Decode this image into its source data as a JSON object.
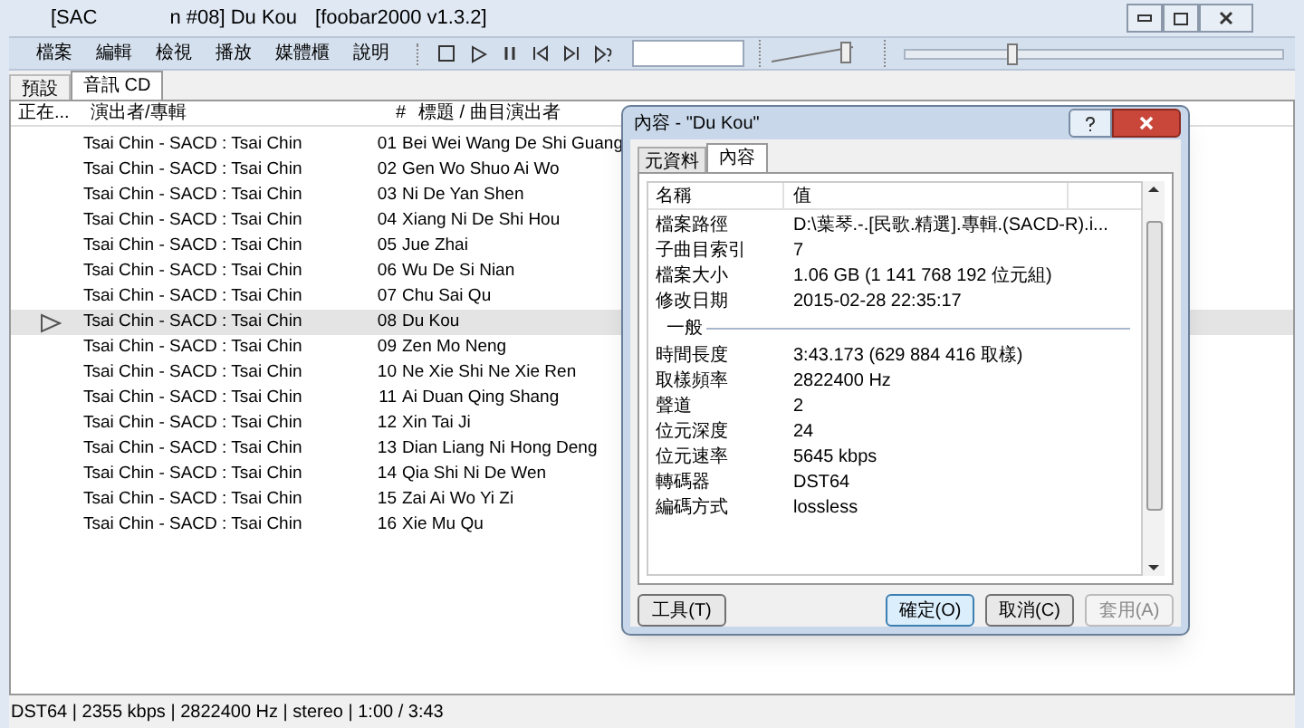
{
  "window": {
    "title_fragments": [
      "[SAC",
      "n #08] Du Kou",
      "[foobar2000 v1.3.2]"
    ]
  },
  "menu": [
    "檔案",
    "編輯",
    "檢視",
    "播放",
    "媒體櫃",
    "說明"
  ],
  "volume": {
    "level": 0.95
  },
  "seek": {
    "level": 0.27
  },
  "tabs": [
    {
      "label": "預設",
      "selected": false
    },
    {
      "label": "音訊 CD",
      "selected": true
    }
  ],
  "playlist": {
    "columns": [
      "正在...",
      "演出者/專輯",
      "#",
      "標題 / 曲目演出者"
    ],
    "rows": [
      {
        "artist": "Tsai Chin - SACD : Tsai Chin",
        "track": "01",
        "title": "Bei Wei Wang De Shi Guang",
        "playing": false,
        "selected": false
      },
      {
        "artist": "Tsai Chin - SACD : Tsai Chin",
        "track": "02",
        "title": "Gen Wo Shuo Ai Wo",
        "playing": false,
        "selected": false
      },
      {
        "artist": "Tsai Chin - SACD : Tsai Chin",
        "track": "03",
        "title": "Ni De Yan Shen",
        "playing": false,
        "selected": false
      },
      {
        "artist": "Tsai Chin - SACD : Tsai Chin",
        "track": "04",
        "title": "Xiang Ni De Shi Hou",
        "playing": false,
        "selected": false
      },
      {
        "artist": "Tsai Chin - SACD : Tsai Chin",
        "track": "05",
        "title": "Jue Zhai",
        "playing": false,
        "selected": false
      },
      {
        "artist": "Tsai Chin - SACD : Tsai Chin",
        "track": "06",
        "title": "Wu De Si Nian",
        "playing": false,
        "selected": false
      },
      {
        "artist": "Tsai Chin - SACD : Tsai Chin",
        "track": "07",
        "title": "Chu Sai Qu",
        "playing": false,
        "selected": false
      },
      {
        "artist": "Tsai Chin - SACD : Tsai Chin",
        "track": "08",
        "title": "Du Kou",
        "playing": true,
        "selected": true
      },
      {
        "artist": "Tsai Chin - SACD : Tsai Chin",
        "track": "09",
        "title": "Zen Mo Neng",
        "playing": false,
        "selected": false
      },
      {
        "artist": "Tsai Chin - SACD : Tsai Chin",
        "track": "10",
        "title": "Ne Xie Shi Ne Xie Ren",
        "playing": false,
        "selected": false
      },
      {
        "artist": "Tsai Chin - SACD : Tsai Chin",
        "track": "11",
        "title": "Ai Duan Qing Shang",
        "playing": false,
        "selected": false
      },
      {
        "artist": "Tsai Chin - SACD : Tsai Chin",
        "track": "12",
        "title": "Xin Tai Ji",
        "playing": false,
        "selected": false
      },
      {
        "artist": "Tsai Chin - SACD : Tsai Chin",
        "track": "13",
        "title": "Dian Liang Ni Hong Deng",
        "playing": false,
        "selected": false
      },
      {
        "artist": "Tsai Chin - SACD : Tsai Chin",
        "track": "14",
        "title": "Qia Shi Ni De Wen",
        "playing": false,
        "selected": false
      },
      {
        "artist": "Tsai Chin - SACD : Tsai Chin",
        "track": "15",
        "title": "Zai Ai Wo Yi Zi",
        "playing": false,
        "selected": false
      },
      {
        "artist": "Tsai Chin - SACD : Tsai Chin",
        "track": "16",
        "title": "Xie Mu Qu",
        "playing": false,
        "selected": false
      }
    ]
  },
  "status_bar": "DST64 | 2355 kbps | 2822400 Hz | stereo | 1:00 / 3:43",
  "dialog": {
    "title": "內容 - \"Du Kou\"",
    "tabs": [
      {
        "label": "元資料",
        "selected": false
      },
      {
        "label": "內容",
        "selected": true
      }
    ],
    "columns": [
      "名稱",
      "值"
    ],
    "rows": [
      {
        "kind": "row",
        "name": "檔案路徑",
        "value": "D:\\葉琴.-.[民歌.精選].專輯.(SACD-R).i..."
      },
      {
        "kind": "row",
        "name": "子曲目索引",
        "value": "7"
      },
      {
        "kind": "row",
        "name": "檔案大小",
        "value": "1.06 GB (1 141 768 192 位元組)"
      },
      {
        "kind": "row",
        "name": "修改日期",
        "value": "2015-02-28 22:35:17"
      },
      {
        "kind": "section",
        "name": "一般"
      },
      {
        "kind": "row",
        "name": "時間長度",
        "value": "3:43.173 (629 884 416 取樣)"
      },
      {
        "kind": "row",
        "name": "取樣頻率",
        "value": "2822400 Hz"
      },
      {
        "kind": "row",
        "name": "聲道",
        "value": "2"
      },
      {
        "kind": "row",
        "name": "位元深度",
        "value": "24"
      },
      {
        "kind": "row",
        "name": "位元速率",
        "value": "5645 kbps"
      },
      {
        "kind": "row",
        "name": "轉碼器",
        "value": "DST64"
      },
      {
        "kind": "row",
        "name": "編碼方式",
        "value": "lossless"
      }
    ],
    "buttons": [
      {
        "label": "工具(T)",
        "disabled": false,
        "default": false
      },
      {
        "label": "確定(O)",
        "disabled": false,
        "default": true
      },
      {
        "label": "取消(C)",
        "disabled": false,
        "default": false
      },
      {
        "label": "套用(A)",
        "disabled": true,
        "default": false
      }
    ]
  }
}
